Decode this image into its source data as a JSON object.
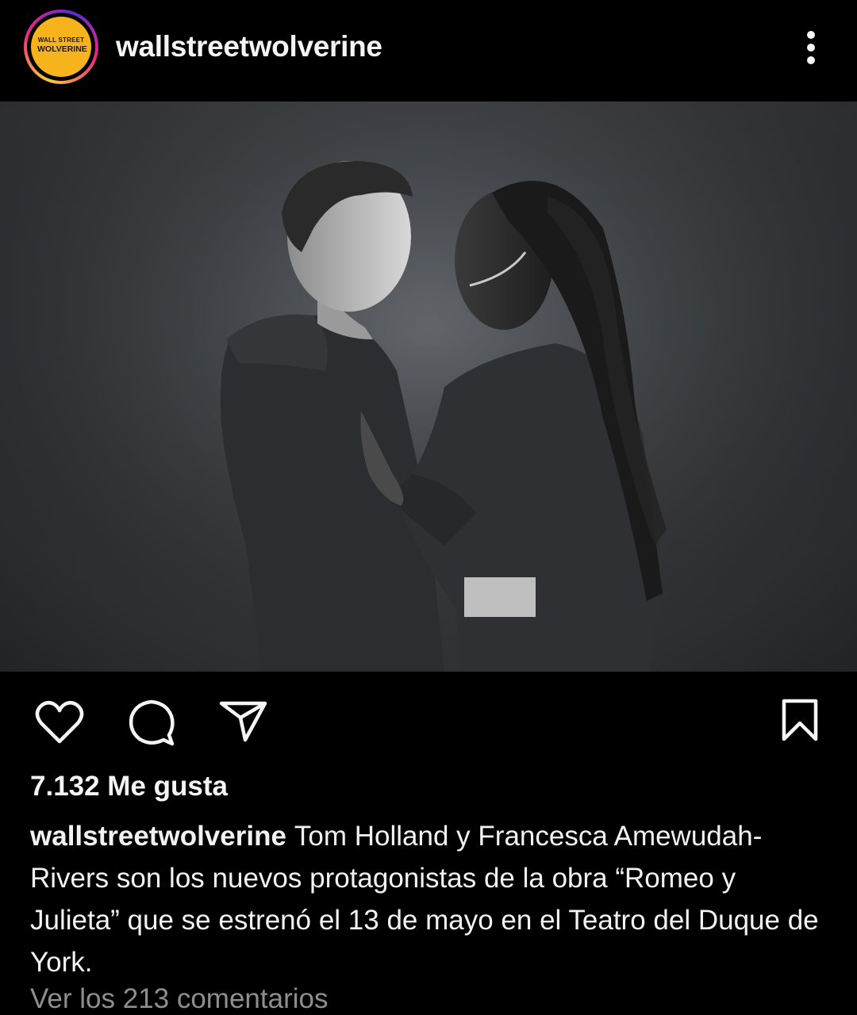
{
  "post": {
    "username": "wallstreetwolverine",
    "avatar": {
      "logo_line1": "WALL STREET",
      "logo_line2": "WOLVERINE",
      "color": "#f7b31c"
    },
    "photo": {
      "description_icon": "photo-icon"
    },
    "actions": {
      "like_icon": "heart-icon",
      "comment_icon": "comment-icon",
      "share_icon": "send-icon",
      "save_icon": "bookmark-icon"
    },
    "likes": "7.132 Me gusta",
    "caption": {
      "username": "wallstreetwolverine",
      "text": "Tom Holland y Francesca Amewudah-Rivers son los nuevos protagonistas de la obra “Romeo y Julieta” que se estrenó el 13 de mayo en el Teatro del Duque de York."
    },
    "comments_link": "Ver los 213 comentarios"
  },
  "colors": {
    "background": "#000000",
    "text": "#f5f5f5",
    "muted": "#8e8e8e"
  }
}
